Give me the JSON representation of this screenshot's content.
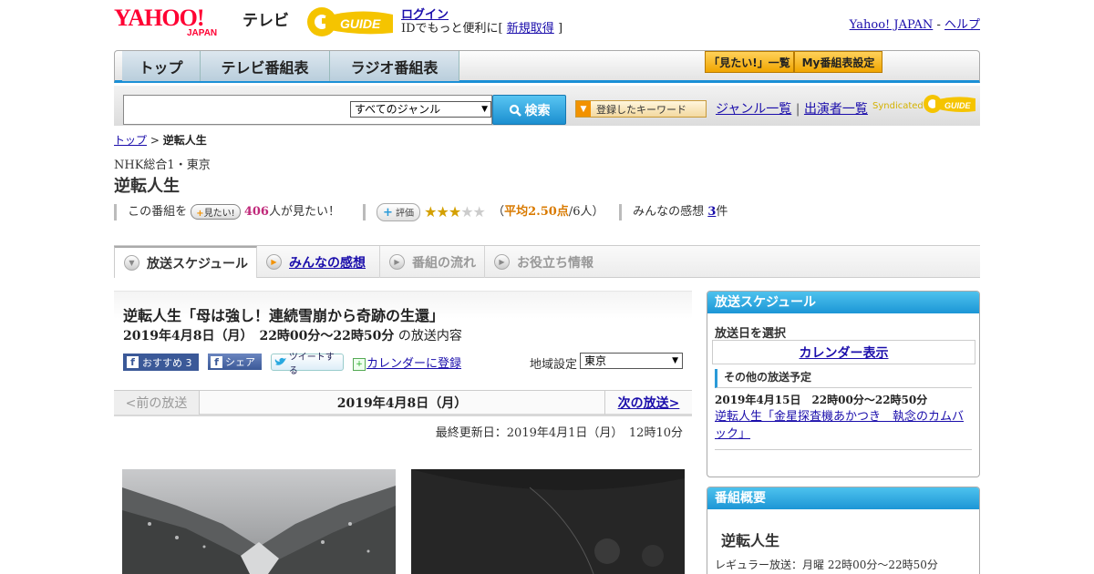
{
  "header": {
    "logo_brand": "YAHOO! JAPAN",
    "logo_tv": "テレビ",
    "logo_gguide": "G-GUIDE",
    "login_label": "ログイン",
    "login_sub_prefix": "IDでもっと便利に[",
    "signup_label": "新規取得",
    "login_sub_suffix": "]",
    "yahoo_japan_link": "Yahoo! JAPAN",
    "separator": "-",
    "help_link": "ヘルプ"
  },
  "nav": {
    "tabs": [
      {
        "label": "トップ"
      },
      {
        "label": "テレビ番組表"
      },
      {
        "label": "ラジオ番組表"
      }
    ],
    "mitai_list": "「見たい!」一覧",
    "my_schedule": "My番組表設定"
  },
  "search": {
    "value": "",
    "genre_selected": "すべてのジャンル",
    "button_label": "検索",
    "keyword_button": "登録したキーワード",
    "genre_list_link": "ジャンル一覧",
    "pipe": "|",
    "performer_list_link": "出演者一覧",
    "syndicated": "Syndicated"
  },
  "breadcrumb": {
    "top": "トップ",
    "sep": ">",
    "current": "逆転人生"
  },
  "program": {
    "channel": "NHK総合1・東京",
    "title": "逆転人生",
    "mitai_prefix": "この番組を",
    "mitai_button": "見たい!",
    "mitai_count": "406",
    "mitai_suffix": "人が見たい！",
    "hyoka_button": "評価",
    "rating_value": 2.5,
    "rating_open": "（",
    "rating_avg": "平均2.50点",
    "rating_people": "/6人）",
    "kanso_prefix": "みんなの感想",
    "kanso_count": "3",
    "kanso_suffix": "件"
  },
  "tabs": [
    {
      "label": "放送スケジュール"
    },
    {
      "label": "みんなの感想"
    },
    {
      "label": "番組の流れ"
    },
    {
      "label": "お役立ち情報"
    }
  ],
  "episode": {
    "title": "逆転人生「母は強し！連続雪崩から奇跡の生還」",
    "date_time": "2019年4月8日（月）　22時00分～22時50分",
    "date_suffix": "の放送内容",
    "fb_recommend": "おすすめ 3",
    "fb_share": "シェア",
    "tweet": "ツイートする",
    "calendar_add": "カレンダーに登録",
    "region_label": "地域設定",
    "region_selected": "東京",
    "prev": "<前の放送",
    "current_date": "2019年4月8日（月）",
    "next": "次の放送>",
    "last_update": "最終更新日：2019年4月1日（月）　12時10分"
  },
  "sidebar": {
    "schedule_title": "放送スケジュール",
    "select_date_label": "放送日を選択",
    "calendar_link": "カレンダー表示",
    "other_label": "その他の放送予定",
    "other_date": "2019年4月15日　22時00分～22時50分",
    "other_title": "逆転人生「金星探査機あかつき　執念のカムバック」",
    "outline_title": "番組概要",
    "outline_program": "逆転人生",
    "outline_regular": "レギュラー放送：月曜 22時00分～22時50分"
  },
  "colors": {
    "accent_blue": "#1c96d6",
    "link": "#1a0dab",
    "mitai_count": "#c0297a",
    "rating_orange": "#d97a00",
    "yahoo_red": "#ff0033"
  }
}
